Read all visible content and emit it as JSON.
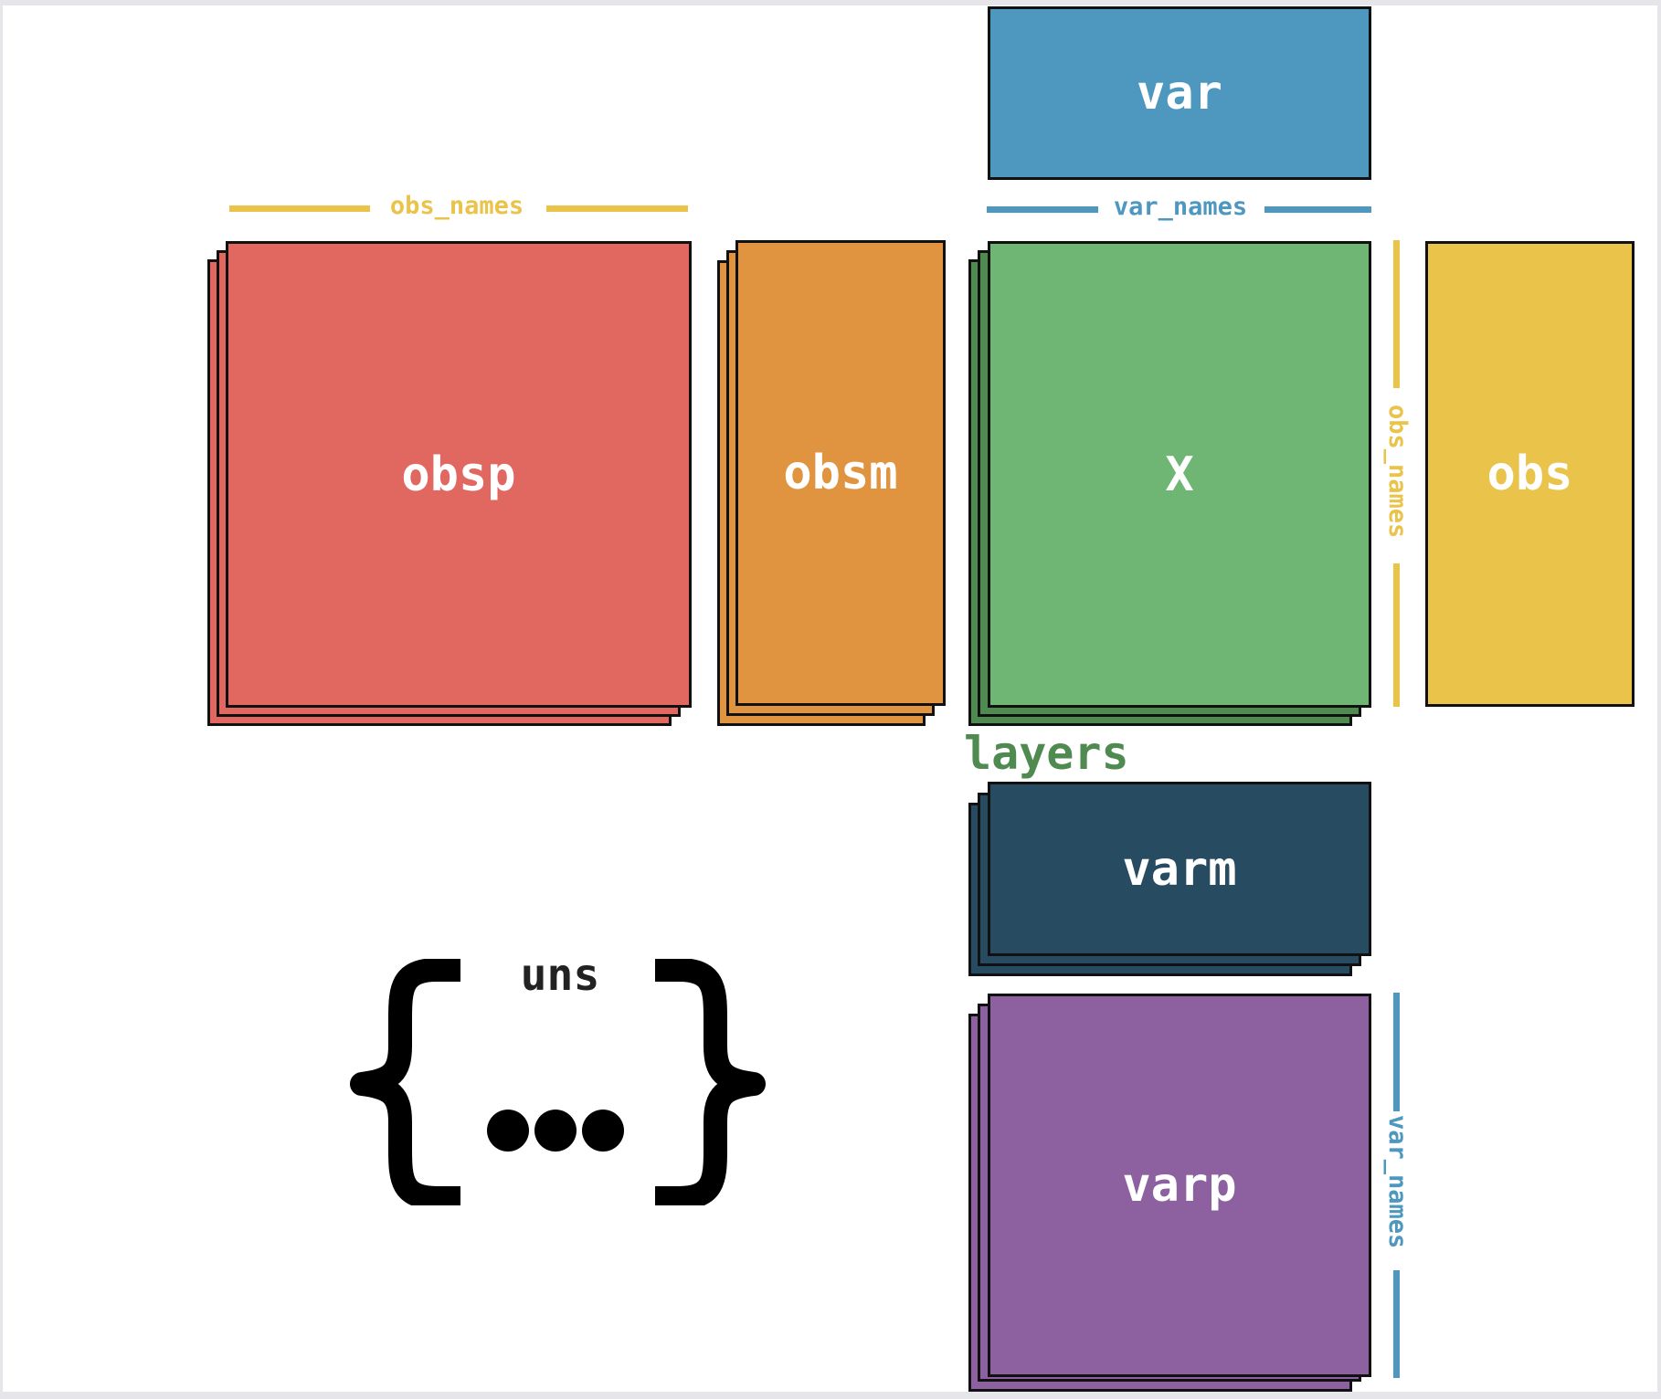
{
  "blocks": {
    "var": {
      "label": "var",
      "color": "#4e97be"
    },
    "obsp": {
      "label": "obsp",
      "color": "#e06861"
    },
    "obsm": {
      "label": "obsm",
      "color": "#e1943f"
    },
    "X": {
      "label": "X",
      "color": "#6fb674"
    },
    "obs": {
      "label": "obs",
      "color": "#e9c34a"
    },
    "varm": {
      "label": "varm",
      "color": "#274b60"
    },
    "varp": {
      "label": "varp",
      "color": "#8d60a0"
    }
  },
  "stack_colors": {
    "obsp": "#e06861",
    "obsm": "#e1943f",
    "X": "#4f8a50",
    "varm": "#274b60",
    "varp": "#8d60a0"
  },
  "name_labels": {
    "obs_names_top": "obs_names",
    "var_names_top": "var_names",
    "obs_names_side": "obs_names",
    "var_names_side": "var_names"
  },
  "colors": {
    "obs_names": "#e9c34a",
    "var_names": "#4e97be",
    "layers": "#4f8a50"
  },
  "layers_label": "layers",
  "uns_label": "uns"
}
